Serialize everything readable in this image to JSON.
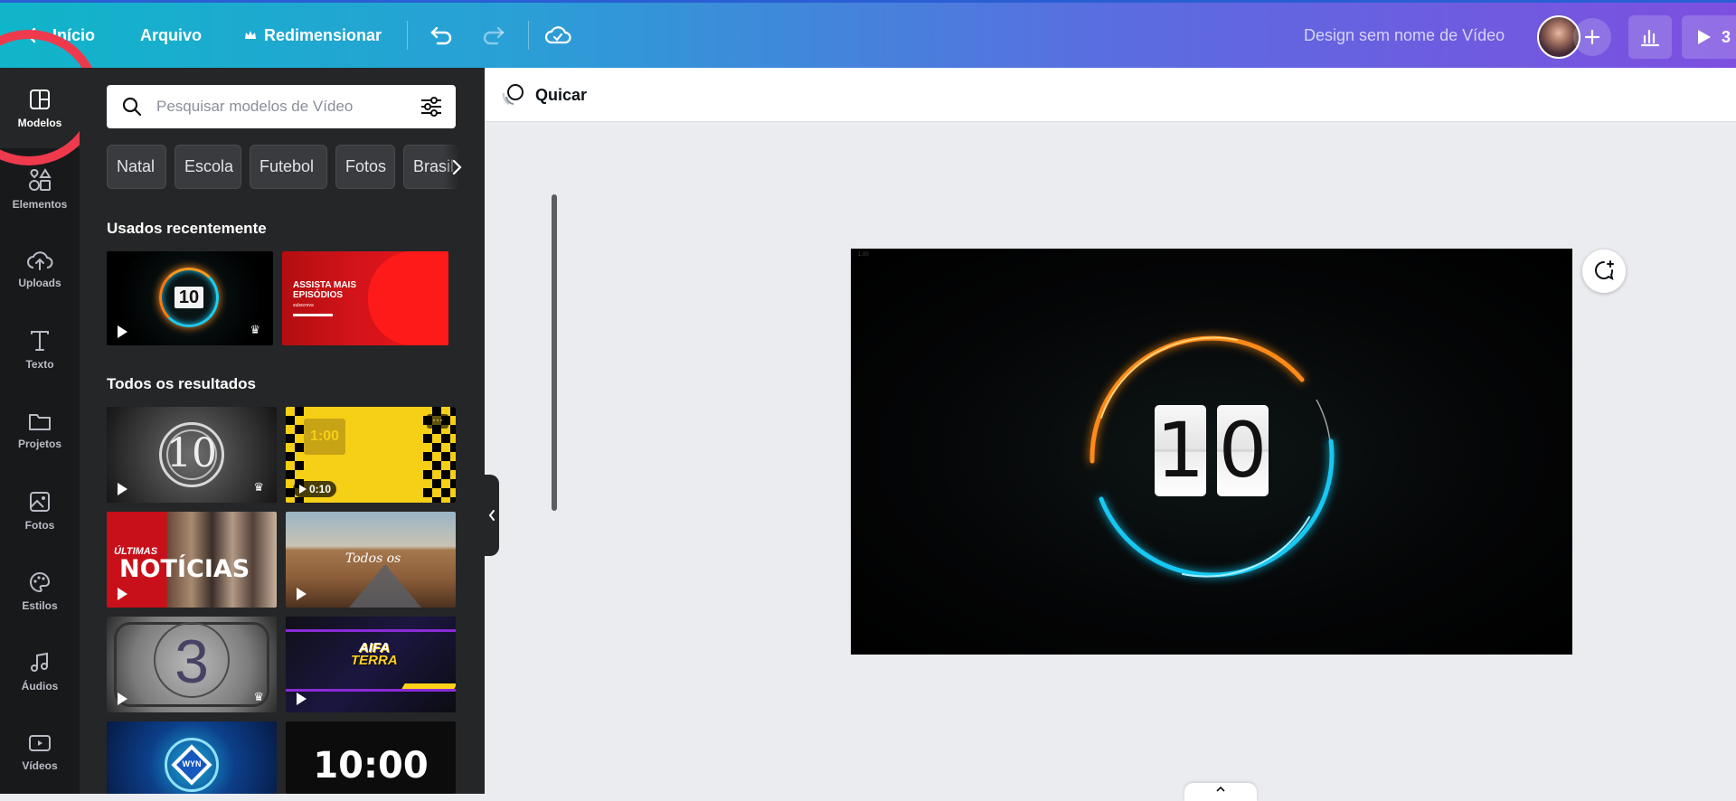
{
  "topbar": {
    "back_label": "Início",
    "file_label": "Arquivo",
    "resize_label": "Redimensionar",
    "design_title": "Design sem nome de Vídeo",
    "present_label": "3",
    "crown_icon": "crown-icon"
  },
  "rail": {
    "items": [
      {
        "label": "Modelos",
        "icon": "layout-icon"
      },
      {
        "label": "Elementos",
        "icon": "shapes-icon"
      },
      {
        "label": "Uploads",
        "icon": "cloud-upload-icon"
      },
      {
        "label": "Texto",
        "icon": "text-icon"
      },
      {
        "label": "Projetos",
        "icon": "folder-icon"
      },
      {
        "label": "Fotos",
        "icon": "image-icon"
      },
      {
        "label": "Estilos",
        "icon": "palette-icon"
      },
      {
        "label": "Áudios",
        "icon": "music-icon"
      },
      {
        "label": "Vídeos",
        "icon": "video-icon"
      }
    ]
  },
  "panel": {
    "search_placeholder": "Pesquisar modelos de Vídeo",
    "chips": [
      "Natal",
      "Escola",
      "Futebol",
      "Fotos",
      "Brasil"
    ],
    "recent_title": "Usados recentemente",
    "results_title": "Todos os resultados",
    "recent": {
      "countdown_number": "10",
      "promo_line1": "ASSISTA MAIS",
      "promo_line2": "EPISÓDIOS",
      "promo_small": "subscreva"
    },
    "results": {
      "film_number": "10",
      "checker_time": "1:00",
      "checker_duration": "0:10",
      "news_small": "ÚLTIMAS",
      "news_big": "NOTÍCIAS",
      "road_text": "Todos os",
      "film3_number": "3",
      "gaming_line1": "AIFA",
      "gaming_line2": "TERRA",
      "tech_logo": "WYN",
      "clock_time": "10:00"
    }
  },
  "canvas": {
    "animation_label": "Quicar",
    "frame_corner": "1.00",
    "digit_1": "1",
    "digit_2": "0"
  }
}
